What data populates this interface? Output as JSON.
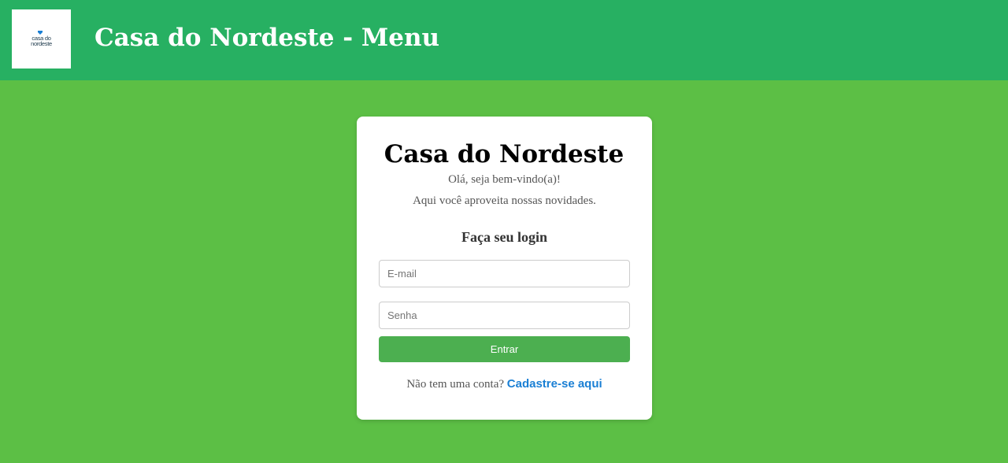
{
  "header": {
    "logo": {
      "line1": "casa do",
      "line2": "nordeste",
      "mark_color": "#1a7fd4"
    },
    "title": "Casa do Nordeste - Menu"
  },
  "card": {
    "title": "Casa do Nordeste",
    "greeting": "Olá, seja bem-vindo(a)!",
    "subtitle": "Aqui você aproveita nossas novidades.",
    "login_heading": "Faça seu login",
    "email_placeholder": "E-mail",
    "password_placeholder": "Senha",
    "submit_label": "Entrar",
    "signup_prompt": "Não tem uma conta?",
    "signup_link": "Cadastre-se aqui"
  },
  "colors": {
    "header_bg": "#27b062",
    "page_bg": "#5cbf45",
    "button_bg": "#4caf50",
    "link": "#1a7fd4"
  }
}
